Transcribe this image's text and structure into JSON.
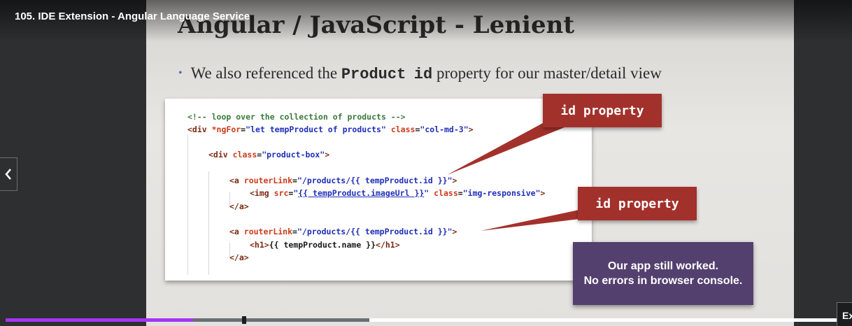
{
  "lecture": {
    "title": "105. IDE Extension - Angular Language Service"
  },
  "slide": {
    "title": "Angular / JavaScript - Lenient",
    "bullet": {
      "pre": "We also referenced the ",
      "code1": "Product",
      "code2": "id",
      "post": " property for our master/detail view"
    },
    "code": {
      "l1": "<!-- loop over the collection of products -->",
      "l2_tag": "<div ",
      "l2_attr1": "*ngFor",
      "l2_eq1": "=",
      "l2_str1": "\"let tempProduct of products\"",
      "l2_attr2": " class",
      "l2_eq2": "=",
      "l2_str2": "\"col-md-3\"",
      "l2_end": ">",
      "l3_tag": "<div ",
      "l3_attr": "class",
      "l3_eq": "=",
      "l3_str": "\"product-box\"",
      "l3_end": ">",
      "l4_tag": "<a ",
      "l4_attr": "routerLink",
      "l4_eq": "=",
      "l4_str": "\"/products/{{ tempProduct.id }}\"",
      "l4_end": ">",
      "l5_tag": "<img ",
      "l5_attr": "src",
      "l5_eq": "=",
      "l5_q1": "\"",
      "l5_str": "{{ tempProduct.imageUrl }}",
      "l5_q2": "\"",
      "l5_attr2": " class",
      "l5_eq2": "=",
      "l5_str2": "\"img-responsive\"",
      "l5_end": ">",
      "l6": "</a>",
      "l7_tag": "<a ",
      "l7_attr": "routerLink",
      "l7_eq": "=",
      "l7_str": "\"/products/{{ tempProduct.id }}\"",
      "l7_end": ">",
      "l8_open": "<h1>",
      "l8_text": "{{ tempProduct.name }}",
      "l8_close": "</h1>",
      "l9": "</a>"
    },
    "callout1": "id property",
    "callout2": "id property",
    "note_line1": "Our app still worked.",
    "note_line2": "No errors in browser console."
  },
  "player": {
    "progress_fraction": 0.225,
    "buffered_fraction": 0.437,
    "expand_label": "Ex",
    "accent_color": "#a435f0"
  },
  "icons": {
    "prev": "chevron-left-icon"
  }
}
